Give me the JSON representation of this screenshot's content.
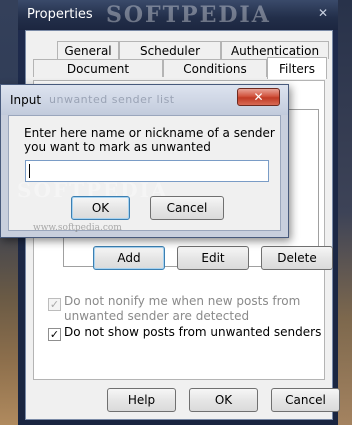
{
  "main_window": {
    "title": "Properties",
    "close_glyph": "✕",
    "tabs_row_back": [
      "General",
      "Scheduler",
      "Authentication"
    ],
    "tabs_row_front": [
      "Document",
      "Conditions",
      "Filters"
    ],
    "active_tab": "Filters",
    "buttons": {
      "add": "Add",
      "edit": "Edit",
      "delete": "Delete"
    },
    "checkboxes": [
      {
        "label": "Do not nonify me when new posts from unwanted sender are detected",
        "checked": true,
        "enabled": false
      },
      {
        "label": "Do not show posts from unwanted senders",
        "checked": true,
        "enabled": true
      }
    ],
    "footer_buttons": {
      "help": "Help",
      "ok": "OK",
      "cancel": "Cancel"
    }
  },
  "input_dialog": {
    "title": "Input",
    "title_faded": "unwanted sender list",
    "prompt": "Enter here name or nickname of a sender you want to mark as unwanted",
    "value": "",
    "ok_label": "OK",
    "cancel_label": "Cancel",
    "close_glyph": "✕"
  },
  "watermark": {
    "top": "SOFTPEDIA",
    "middle": "SOFTPEDIA",
    "small": "www.softpedia.com"
  },
  "colors": {
    "title_bar": "#1e2b4d",
    "dialog_frame": "#c8cfdd",
    "close_button": "#c84330",
    "default_button_border": "#3c7fb1"
  }
}
